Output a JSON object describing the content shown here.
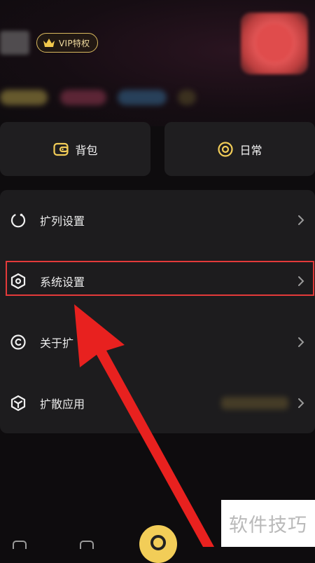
{
  "header": {
    "vip_label": "VIP特权"
  },
  "cards": [
    {
      "label": "背包",
      "icon": "wallet-icon"
    },
    {
      "label": "日常",
      "icon": "target-icon"
    }
  ],
  "menu": [
    {
      "label": "扩列设置",
      "icon": "refresh-circle-icon"
    },
    {
      "label": "系统设置",
      "icon": "hexagon-settings-icon"
    },
    {
      "label": "关于扩",
      "icon": "copyright-icon"
    },
    {
      "label": "扩散应用",
      "icon": "cube-icon"
    }
  ],
  "watermark": {
    "text": "软件技巧"
  },
  "colors": {
    "accent": "#f2cd58",
    "vip_border": "#d8b85e",
    "annotation_red": "#e33a3a",
    "panel": "#1d1c1e",
    "background": "#0e0c0e"
  }
}
